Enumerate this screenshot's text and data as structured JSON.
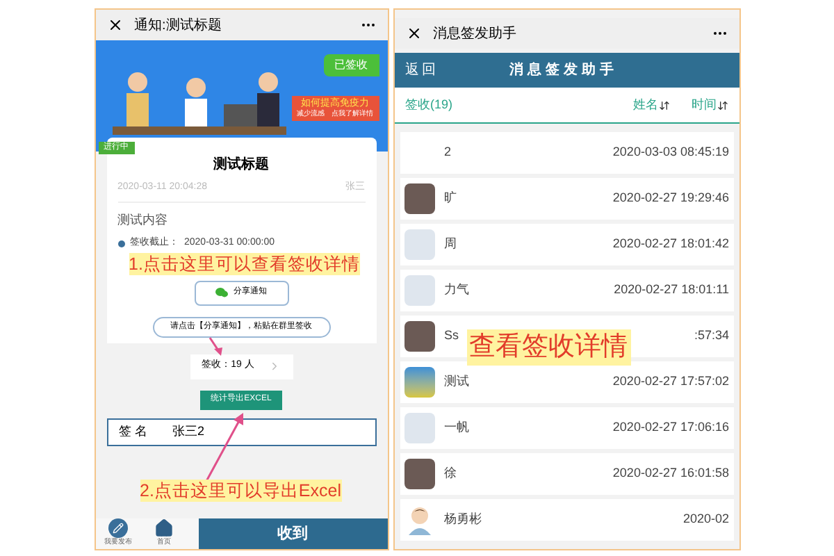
{
  "left_phone": {
    "title": "通知:测试标题",
    "banner": {
      "badge": "已签收",
      "promo_title": "如何提高免疫力",
      "promo_subtitle": "减少流感　点我了解详情"
    },
    "status_tag": "进行中",
    "notice": {
      "title": "测试标题",
      "date": "2020-03-11 20:04:28",
      "author": "张三",
      "content": "测试内容",
      "deadline_label": "签收截止：",
      "deadline": "2020-03-31 00:00:00"
    },
    "share_button": "分享通知",
    "share_hint": "请点击【分享通知】，粘贴在群里签收",
    "sign_count": "签收：19 人",
    "export_button": "统计导出EXCEL",
    "signature": {
      "label": "签 名",
      "value": "张三2"
    },
    "nav": [
      {
        "label": "我要发布",
        "kind": "pencil"
      },
      {
        "label": "首页",
        "kind": "home"
      }
    ],
    "receive_button": "收到",
    "annotations": [
      "1.点击这里可以查看签收详情",
      "2.点击这里可以导出Excel"
    ]
  },
  "right_phone": {
    "title": "消息签发助手",
    "header": {
      "back": "返回",
      "title": "消息签发助手"
    },
    "tabs": [
      {
        "label": "签收(19)",
        "kind": "count"
      },
      {
        "label": "姓名",
        "kind": "sort"
      },
      {
        "label": "时间",
        "kind": "sort"
      }
    ],
    "rows": [
      {
        "name": "2",
        "time": "2020-03-03 08:45:19",
        "kind": "none"
      },
      {
        "name": "旷",
        "time": "2020-02-27 19:29:46",
        "kind": "photo"
      },
      {
        "name": "周",
        "time": "2020-02-27 18:01:42",
        "kind": "blank"
      },
      {
        "name": "力气",
        "time": "2020-02-27 18:01:11",
        "kind": "blank"
      },
      {
        "name": "Ss",
        "time": ":57:34",
        "kind": "photo"
      },
      {
        "name": "测试",
        "time": "2020-02-27 17:57:02",
        "kind": "landscape"
      },
      {
        "name": "一帆",
        "time": "2020-02-27 17:06:16",
        "kind": "blank"
      },
      {
        "name": "徐",
        "time": "2020-02-27 16:01:58",
        "kind": "photo"
      },
      {
        "name": "杨勇彬",
        "time": "2020-02",
        "kind": "cartoon"
      }
    ],
    "annotation": "查看签收详情"
  }
}
